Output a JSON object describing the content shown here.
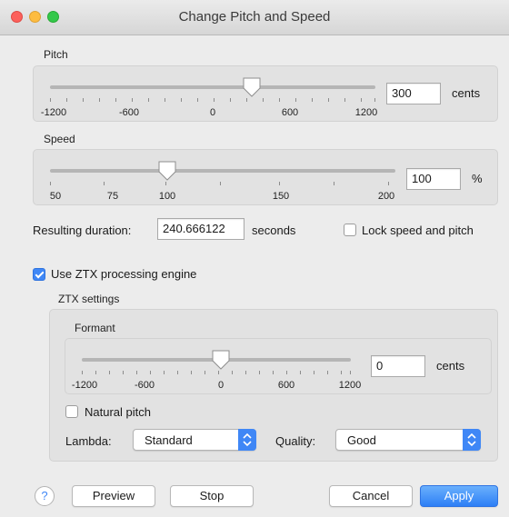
{
  "window": {
    "title": "Change Pitch and Speed"
  },
  "pitch": {
    "label": "Pitch",
    "value": "300",
    "unit": "cents",
    "ticks": [
      "-1200",
      "-600",
      "0",
      "600",
      "1200"
    ]
  },
  "speed": {
    "label": "Speed",
    "value": "100",
    "unit": "%",
    "ticks": [
      "50",
      "75",
      "100",
      "150",
      "200"
    ]
  },
  "duration": {
    "label": "Resulting duration:",
    "value": "240.666122",
    "unit": "seconds"
  },
  "lock": {
    "label": "Lock speed and pitch",
    "checked": false
  },
  "ztx": {
    "engine_label": "Use ZTX processing engine",
    "engine_checked": true,
    "settings_label": "ZTX settings",
    "formant": {
      "label": "Formant",
      "value": "0",
      "unit": "cents",
      "ticks": [
        "-1200",
        "-600",
        "0",
        "600",
        "1200"
      ]
    },
    "natural_pitch": {
      "label": "Natural pitch",
      "checked": false
    },
    "lambda": {
      "label": "Lambda:",
      "value": "Standard"
    },
    "quality": {
      "label": "Quality:",
      "value": "Good"
    }
  },
  "buttons": {
    "help": "?",
    "preview": "Preview",
    "stop": "Stop",
    "cancel": "Cancel",
    "apply": "Apply"
  },
  "colors": {
    "accent": "#3f87f6",
    "panel": "#e2e2e2",
    "window": "#ececec"
  }
}
